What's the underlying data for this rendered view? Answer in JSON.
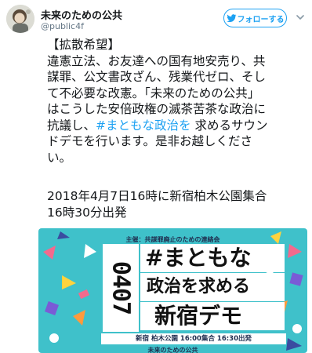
{
  "tweet": {
    "author": {
      "name": "未来のための公共",
      "handle": "@public4f",
      "avatar_icon": "avatar-illustration"
    },
    "follow_label": "フォローする",
    "menu_icon": "chevron-down-icon",
    "text_lines": [
      "【拡散希望】",
      "違憲立法、お友達への国有地安売り、共",
      "謀罪、公文書改ざん、残業代ゼロ、そし",
      "て不必要な改憲。「未来のための公共」",
      "はこうした安倍政権の滅茶苦茶な政治に"
    ],
    "line6_before": "抗議し、",
    "hashtag": "#まともな政治を",
    "line6_after": " 求めるサウン",
    "text_tail_lines": [
      "ドデモを行います。是非お越しくださ",
      "い。"
    ],
    "date_lines": [
      "2018年4月7日16時に新宿柏木公園集合",
      "16時30分出発"
    ],
    "accent_color": "#1da1f2"
  },
  "poster": {
    "organizer": "主催：共謀罪廃止のための連絡会",
    "date_vertical": "0407",
    "headline_1": "#まともな",
    "headline_2": "政治を求める",
    "headline_3": "新宿デモ",
    "venue_line": "新宿 柏木公園 16:00集合 16:30出発",
    "footer": "未来のための公共",
    "background_color": "#3fc1ca"
  }
}
